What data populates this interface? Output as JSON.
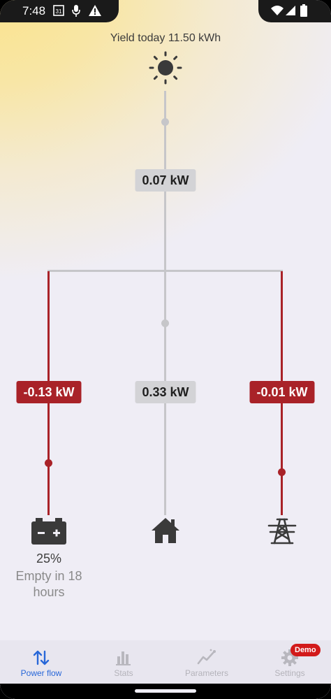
{
  "status_bar": {
    "time": "7:48",
    "left_icons": [
      "calendar-icon",
      "mic-icon",
      "warning-icon"
    ],
    "right_icons": [
      "wifi-icon",
      "signal-icon",
      "battery-icon"
    ],
    "calendar_day": "31"
  },
  "flow": {
    "yield_text": "Yield today 11.50 kWh",
    "solar_power": "0.07 kW",
    "battery_power": "-0.13 kW",
    "home_power": "0.33 kW",
    "grid_power": "-0.01 kW",
    "battery_percent": "25%",
    "battery_time": "Empty in 18 hours",
    "colors": {
      "grey_line": "#c6c6c9",
      "red_line": "#a92228",
      "icon": "#3a3a3a"
    },
    "icons": [
      "sun-icon",
      "battery-icon",
      "house-icon",
      "power-pylon-icon"
    ]
  },
  "nav": {
    "items": [
      {
        "label": "Power flow",
        "icon": "arrows-updown-icon",
        "active": true
      },
      {
        "label": "Stats",
        "icon": "bar-chart-icon",
        "active": false
      },
      {
        "label": "Parameters",
        "icon": "trend-line-icon",
        "active": false
      },
      {
        "label": "Settings",
        "icon": "gear-icon",
        "active": false
      }
    ],
    "demo_badge": "Demo",
    "active_color": "#2867d8"
  }
}
